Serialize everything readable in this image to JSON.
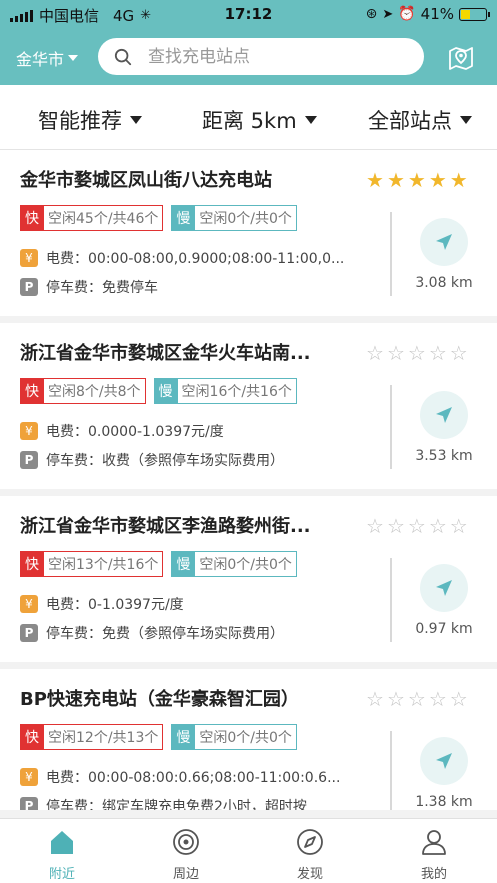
{
  "status_bar": {
    "carrier": "中国电信",
    "network": "4G",
    "time": "17:12",
    "battery": "41%",
    "battery_level": 0.41
  },
  "header": {
    "city": "金华市",
    "search_placeholder": "查找充电站点"
  },
  "filters": [
    {
      "label": "智能推荐"
    },
    {
      "label": "距离 5km"
    },
    {
      "label": "全部站点"
    }
  ],
  "stations": [
    {
      "name": "金华市婺城区凤山街八达充电站",
      "rating": 5,
      "fast_type": "快",
      "fast_counts": "空闲45个/共46个",
      "slow_type": "慢",
      "slow_counts": "空闲0个/共0个",
      "electric_fee": "电费：00:00-08:00,0.9000;08:00-11:00,0...",
      "parking_fee": "停车费：免费停车",
      "distance": "3.08 km"
    },
    {
      "name": "浙江省金华市婺城区金华火车站南...",
      "rating": 0,
      "fast_type": "快",
      "fast_counts": "空闲8个/共8个",
      "slow_type": "慢",
      "slow_counts": "空闲16个/共16个",
      "electric_fee": "电费：0.0000-1.0397元/度",
      "parking_fee": "停车费：收费（参照停车场实际费用）",
      "distance": "3.53 km"
    },
    {
      "name": "浙江省金华市婺城区李渔路婺州街...",
      "rating": 0,
      "fast_type": "快",
      "fast_counts": "空闲13个/共16个",
      "slow_type": "慢",
      "slow_counts": "空闲0个/共0个",
      "electric_fee": "电费：0-1.0397元/度",
      "parking_fee": "停车费：免费（参照停车场实际费用）",
      "distance": "0.97 km"
    },
    {
      "name": "BP快速充电站（金华豪森智汇园）",
      "rating": 0,
      "fast_type": "快",
      "fast_counts": "空闲12个/共13个",
      "slow_type": "慢",
      "slow_counts": "空闲0个/共0个",
      "electric_fee": "电费：00:00-08:00:0.66;08:00-11:00:0.6...",
      "parking_fee": "停车费：绑定车牌充电免费2小时，超时按",
      "distance": "1.38 km"
    }
  ],
  "tabs": [
    {
      "label": "附近",
      "icon": "home-icon",
      "active": true
    },
    {
      "label": "周边",
      "icon": "target-icon",
      "active": false
    },
    {
      "label": "发现",
      "icon": "compass-icon",
      "active": false
    },
    {
      "label": "我的",
      "icon": "user-icon",
      "active": false
    }
  ],
  "colors": {
    "brand": "#68bfbf",
    "fast": "#e03232",
    "slow": "#5cb8bf",
    "star": "#f1b72c"
  }
}
